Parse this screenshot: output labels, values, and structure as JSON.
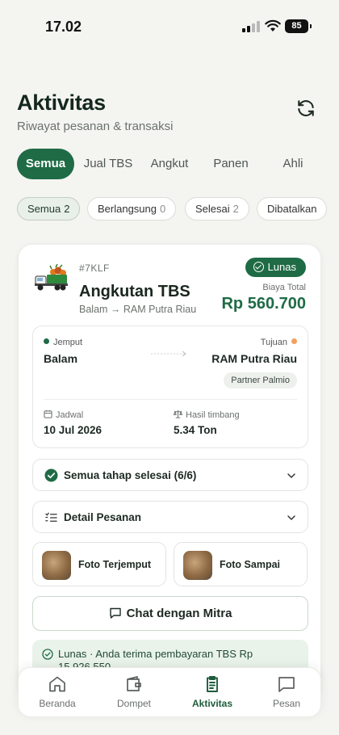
{
  "status_bar": {
    "time": "17.02",
    "battery": "85"
  },
  "header": {
    "title": "Aktivitas",
    "subtitle": "Riwayat pesanan & transaksi"
  },
  "tabs": [
    {
      "label": "Semua",
      "active": true
    },
    {
      "label": "Jual TBS",
      "active": false
    },
    {
      "label": "Angkut",
      "active": false
    },
    {
      "label": "Panen",
      "active": false
    },
    {
      "label": "Ahli",
      "active": false
    }
  ],
  "filters": [
    {
      "label": "Semua",
      "count": "2",
      "active": true
    },
    {
      "label": "Berlangsung",
      "count": "0",
      "active": false
    },
    {
      "label": "Selesai",
      "count": "2",
      "active": false
    },
    {
      "label": "Dibatalkan",
      "count": "",
      "active": false
    }
  ],
  "order": {
    "id": "#7KLF",
    "title": "Angkutan TBS",
    "route": "Balam → RAM Putra Riau",
    "status": "Lunas",
    "cost_label": "Biaya Total",
    "cost_value": "Rp 560.700",
    "pickup_label": "Jemput",
    "pickup_value": "Balam",
    "dest_label": "Tujuan",
    "dest_value": "RAM Putra Riau",
    "partner": "Partner Palmio",
    "schedule_label": "Jadwal",
    "schedule_value": "10 Jul 2026",
    "weight_label": "Hasil timbang",
    "weight_value": "5.34 Ton",
    "steps": "Semua tahap selesai (6/6)",
    "details": "Detail Pesanan",
    "photo_pickup": "Foto Terjemput",
    "photo_arrive": "Foto Sampai",
    "chat": "Chat dengan Mitra",
    "paid_note": "Lunas · Anda terima pembayaran TBS Rp 15.926.550"
  },
  "nav": [
    {
      "label": "Beranda",
      "icon": "home-icon",
      "active": false
    },
    {
      "label": "Dompet",
      "icon": "wallet-icon",
      "active": false
    },
    {
      "label": "Aktivitas",
      "icon": "clipboard-icon",
      "active": true
    },
    {
      "label": "Pesan",
      "icon": "message-icon",
      "active": false
    }
  ],
  "colors": {
    "primary": "#1f6b45",
    "accent_orange": "#f2a05f",
    "background": "#f4f4f1"
  }
}
